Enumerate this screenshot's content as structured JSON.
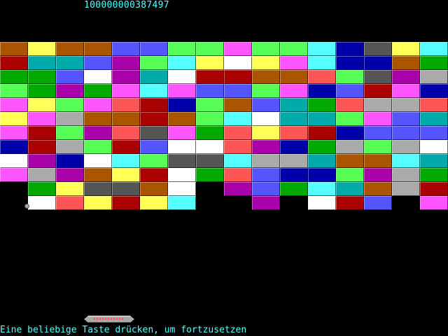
{
  "hud": {
    "score": "100000000387497",
    "prompt": "Eine beliebige Taste drücken, um fortzusetzen"
  },
  "palette": {
    "BR": "#AA5500",
    "Y": "#FFFF55",
    "B": "#5555FF",
    "G": "#55FF55",
    "M": "#FF55FF",
    "C": "#55FFFF",
    "DB": "#0000AA",
    "DG": "#555555",
    "R": "#AA0000",
    "T": "#00AAAA",
    "LR": "#FF5555",
    "GR": "#00AA00",
    "W": "#FFFFFF",
    "PU": "#AA00AA",
    "LG": "#AAAAAA"
  },
  "bricks": [
    [
      "BR",
      "Y",
      "BR",
      "BR",
      "B",
      "B",
      "G",
      "G",
      "M",
      "G",
      "G",
      "C",
      "DB",
      "DG",
      "Y",
      "C"
    ],
    [
      "R",
      "T",
      "T",
      "B",
      "PU",
      "G",
      "C",
      "Y",
      "W",
      "Y",
      "M",
      "C",
      "DB",
      "DB",
      "BR",
      "GR"
    ],
    [
      "GR",
      "GR",
      "B",
      "W",
      "PU",
      "T",
      "W",
      "R",
      "R",
      "BR",
      "BR",
      "LR",
      "G",
      "DG",
      "PU",
      "LG"
    ],
    [
      "G",
      "GR",
      "PU",
      "GR",
      "M",
      "C",
      "M",
      "B",
      "B",
      "G",
      "M",
      "DB",
      "B",
      "R",
      "M",
      "DB"
    ],
    [
      "M",
      "Y",
      "G",
      "M",
      "LR",
      "R",
      "DB",
      "G",
      "BR",
      "B",
      "T",
      "GR",
      "LR",
      "LG",
      "LG",
      "LR"
    ],
    [
      "Y",
      "M",
      "LG",
      "BR",
      "BR",
      "R",
      "BR",
      "G",
      "C",
      "W",
      "T",
      "T",
      "G",
      "M",
      "B",
      "T"
    ],
    [
      "M",
      "R",
      "G",
      "PU",
      "LR",
      "DG",
      "M",
      "GR",
      "LR",
      "Y",
      "LR",
      "R",
      "DB",
      "B",
      "B",
      "B"
    ],
    [
      "DB",
      "R",
      "LG",
      "G",
      "R",
      "B",
      "W",
      "W",
      "LR",
      "PU",
      "DB",
      "GR",
      "LG",
      "G",
      "LG",
      "W"
    ],
    [
      "W",
      "PU",
      "DB",
      "W",
      "C",
      "G",
      "DG",
      "DG",
      "C",
      "LG",
      "LG",
      "T",
      "BR",
      "BR",
      "C",
      "T"
    ],
    [
      "M",
      "LG",
      "PU",
      "BR",
      "Y",
      "R",
      "W",
      "GR",
      "LR",
      "B",
      "DB",
      "DB",
      "G",
      "PU",
      "LG",
      "GR"
    ],
    [
      null,
      "GR",
      "Y",
      "DG",
      "DG",
      "BR",
      "W",
      null,
      "PU",
      "B",
      "GR",
      "C",
      "T",
      "BR",
      "LG",
      "R"
    ],
    [
      null,
      "W",
      "LR",
      "Y",
      "R",
      "Y",
      "C",
      null,
      null,
      "PU",
      null,
      "W",
      "R",
      "B",
      null,
      "M"
    ]
  ],
  "paddle": {
    "label": ""
  }
}
